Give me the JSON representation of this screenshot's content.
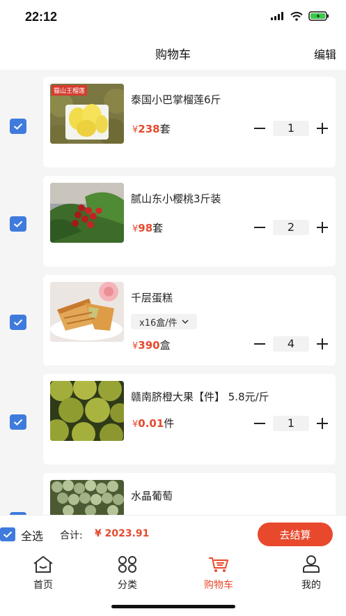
{
  "status": {
    "time": "22:12"
  },
  "nav": {
    "title": "购物车",
    "edit": "编辑"
  },
  "items": [
    {
      "name": "泰国小巴掌榴莲6斤",
      "yen": "¥",
      "price": "238",
      "unit": "套",
      "qty": "1",
      "checked": true,
      "badge": "猫山王榴莲"
    },
    {
      "name": "腻山东小樱桃3斤装",
      "yen": "¥",
      "price": "98",
      "unit": "套",
      "qty": "2",
      "checked": true
    },
    {
      "name": "千层蛋糕",
      "spec": "x16盒/件",
      "yen": "¥",
      "price": "390",
      "unit": "盒",
      "qty": "4",
      "checked": true
    },
    {
      "name": "赣南脐橙大果【件】 5.8元/斤",
      "yen": "¥",
      "price": "0.01",
      "unit": "件",
      "qty": "1",
      "checked": true
    },
    {
      "name": "水晶葡萄",
      "checked": true
    }
  ],
  "footer": {
    "select_all": "全选",
    "total_label": "合计:",
    "total_value": "¥ 2023.91",
    "checkout": "去结算"
  },
  "tabs": [
    {
      "label": "首页",
      "icon": "home-icon"
    },
    {
      "label": "分类",
      "icon": "category-icon"
    },
    {
      "label": "购物车",
      "icon": "cart-icon",
      "active": true
    },
    {
      "label": "我的",
      "icon": "profile-icon"
    }
  ],
  "colors": {
    "accent": "#e8492c",
    "checkbox": "#3f7bdd",
    "price": "#e64a2e"
  }
}
